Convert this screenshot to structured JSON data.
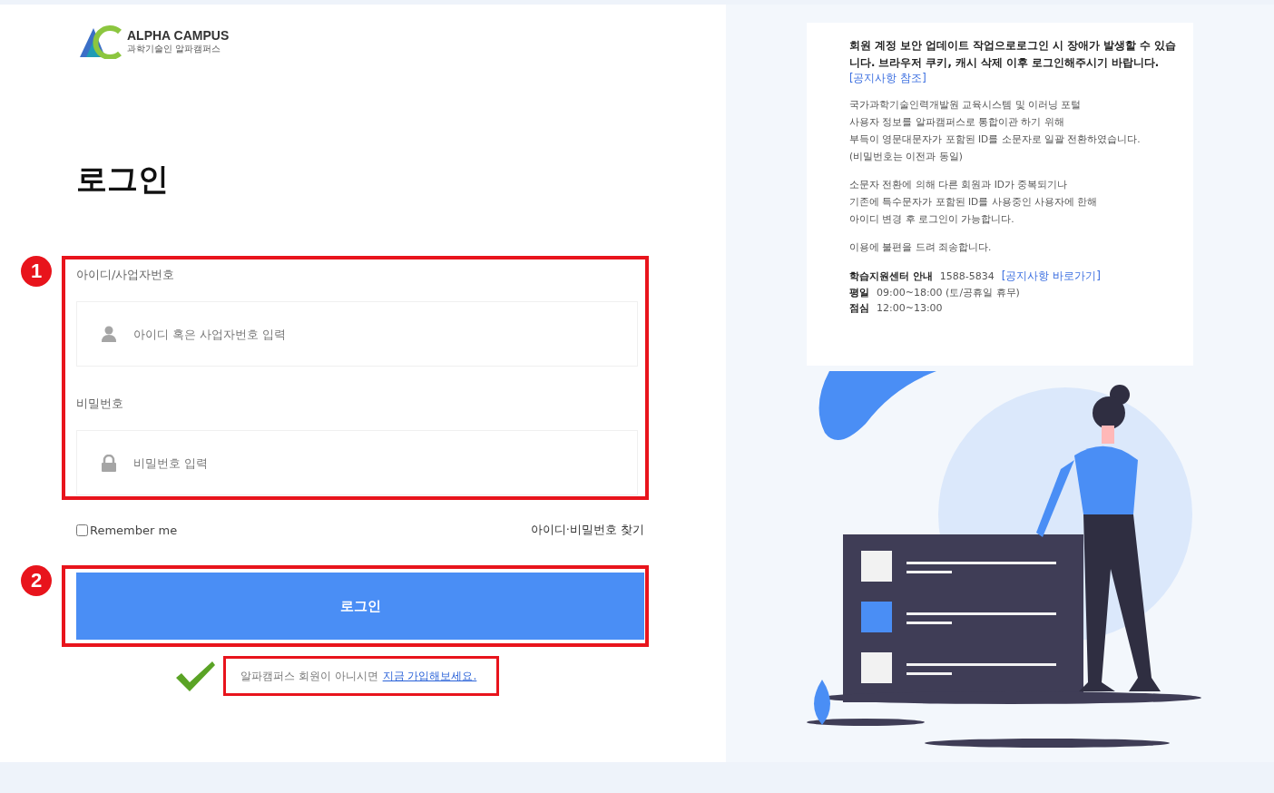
{
  "logo": {
    "name": "ALPHA CAMPUS",
    "tagline": "과학기술인 알파캠퍼스"
  },
  "title": "로그인",
  "annotations": [
    "1",
    "2"
  ],
  "fields": [
    {
      "kind": "user",
      "label": "아이디/사업자번호",
      "placeholder": "아이디 혹은 사업자번호 입력"
    },
    {
      "kind": "password",
      "label": "비밀번호",
      "placeholder": "비밀번호 입력"
    }
  ],
  "remember": {
    "label": "Remember me",
    "checked": false
  },
  "find_link": "아이디·비밀번호 찾기",
  "login_button": "로그인",
  "signup": {
    "text": "알파캠퍼스 회원이 아니시면",
    "link": "지금 가입해보세요."
  },
  "notice": {
    "alert": "회원 계정 보안 업데이트 작업으로로그인 시 장애가 발생할 수 있습니다. 브라우저 쿠키, 캐시 삭제 이후 로그인해주시기 바랍니다.",
    "alert_link": "[공지사항 참조]",
    "paragraphs": [
      [
        "국가과학기술인력개발원 교육시스템 및 이러닝 포털",
        "사용자 정보를 알파캠퍼스로 통합이관 하기 위해",
        "부득이 영문대문자가 포함된 ID를 소문자로 일괄 전환하였습니다.",
        "(비밀번호는 이전과 동일)"
      ],
      [
        "소문자 전환에 의해 다른 회원과 ID가 중복되기나",
        "기존에 특수문자가 포함된 ID를 사용중인 사용자에 한해",
        "아이디 변경 후 로그인이 가능합니다."
      ],
      [
        "이용에 불편을 드려 죄송합니다."
      ]
    ],
    "contact": [
      {
        "label": "학습지원센터 안내",
        "value": "1588-5834",
        "link": "[공지사항 바로가기]"
      },
      {
        "label": "평일",
        "value": "09:00~18:00 (토/공휴일 휴무)"
      },
      {
        "label": "점심",
        "value": "12:00~13:00"
      }
    ]
  }
}
